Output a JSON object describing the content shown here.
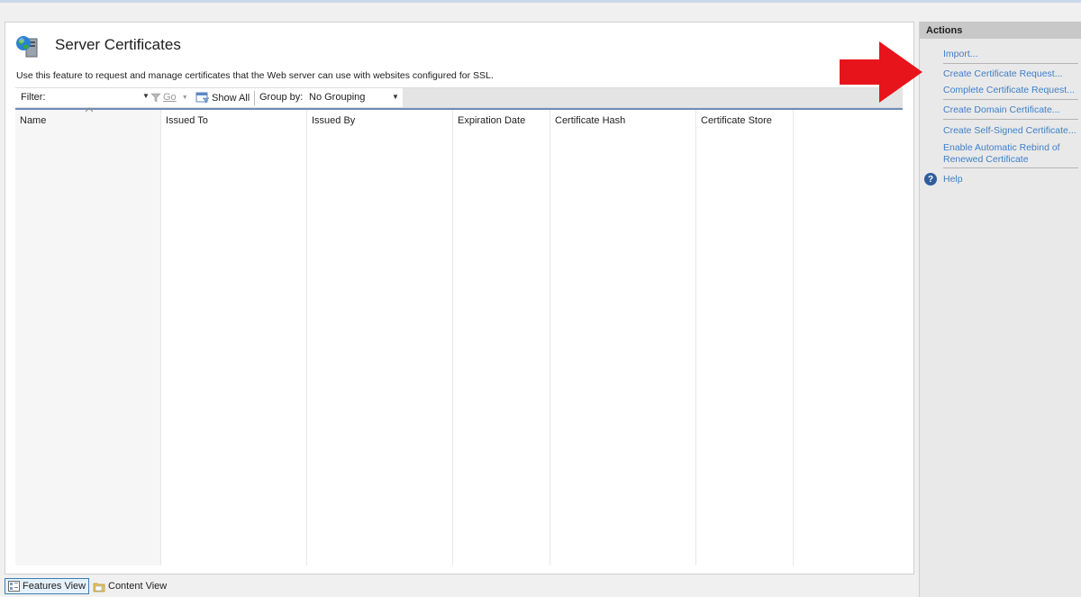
{
  "page": {
    "title": "Server Certificates",
    "description": "Use this feature to request and manage certificates that the Web server can use with websites configured for SSL.",
    "icon": "server-certificates-icon"
  },
  "toolbar": {
    "filter_label": "Filter:",
    "filter_value": "",
    "go_label": "Go",
    "show_all_label": "Show All",
    "group_by_label": "Group by:",
    "group_by_value": "No Grouping"
  },
  "table": {
    "columns": [
      "Name",
      "Issued To",
      "Issued By",
      "Expiration Date",
      "Certificate Hash",
      "Certificate Store"
    ],
    "rows": []
  },
  "view_tabs": {
    "features_view": "Features View",
    "content_view": "Content View"
  },
  "actions": {
    "header": "Actions",
    "import": "Import...",
    "create_request": "Create Certificate Request...",
    "complete_request": "Complete Certificate Request...",
    "create_domain": "Create Domain Certificate...",
    "create_self_signed": "Create Self-Signed Certificate...",
    "enable_rebind": "Enable Automatic Rebind of Renewed Certificate",
    "help": "Help"
  },
  "colors": {
    "action_link": "#3f7fc7",
    "callout_arrow": "#e8141c",
    "list_header_border": "#6f8cb8"
  }
}
